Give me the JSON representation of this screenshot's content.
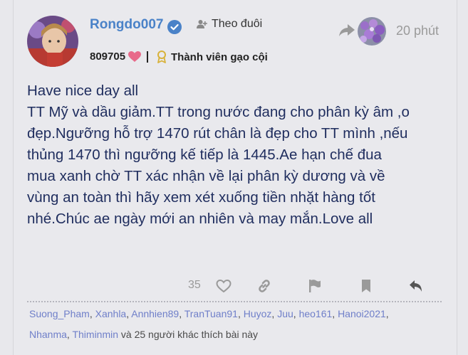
{
  "post": {
    "username": "Rongdo007",
    "follow_label": "Theo đuôi",
    "score": "809705",
    "member_title": "Thành viên gạo cội",
    "time": "20 phút",
    "body_lines": [
      "Have nice day all",
      "TT Mỹ và dầu giảm.TT trong nước đang cho phân kỳ âm ,o",
      "đẹp.Ngưỡng hỗ trợ 1470 rút chân là đẹp cho TT mình ,nếu",
      "thủng 1470 thì ngưỡng kế tiếp là 1445.Ae hạn chế đua",
      "mua xanh chờ TT xác nhận về lại phân kỳ dương và về",
      "vùng an toàn thì hãy xem xét xuống tiền nhặt hàng tốt",
      "nhé.Chúc ae ngày mới an nhiên và may mắn.Love all"
    ],
    "like_count": "35",
    "likers": [
      "Suong_Pham",
      "Xanhla",
      "Annhien89",
      "TranTuan91",
      "Huyoz",
      "Juu",
      "heo161",
      "Hanoi2021",
      "Nhanma",
      "Thiminmin"
    ],
    "likers_sep": ", ",
    "likers_suffix": " và 25 người khác thích bài này"
  },
  "icons": {
    "verified": "verified-badge-icon",
    "follow": "person-plus-icon",
    "heart": "heart-icon",
    "award": "award-ribbon-icon",
    "reply_to": "share-arrow-icon",
    "like": "heart-outline-icon",
    "link": "link-icon",
    "flag": "flag-icon",
    "bookmark": "bookmark-icon",
    "reply": "reply-icon"
  },
  "colors": {
    "username": "#4a82c8",
    "verified": "#4a82c8",
    "heart": "#e86a8a",
    "body_text": "#1f2d5e",
    "liker_name": "#6f7fc9",
    "muted": "#9a9a9a"
  }
}
